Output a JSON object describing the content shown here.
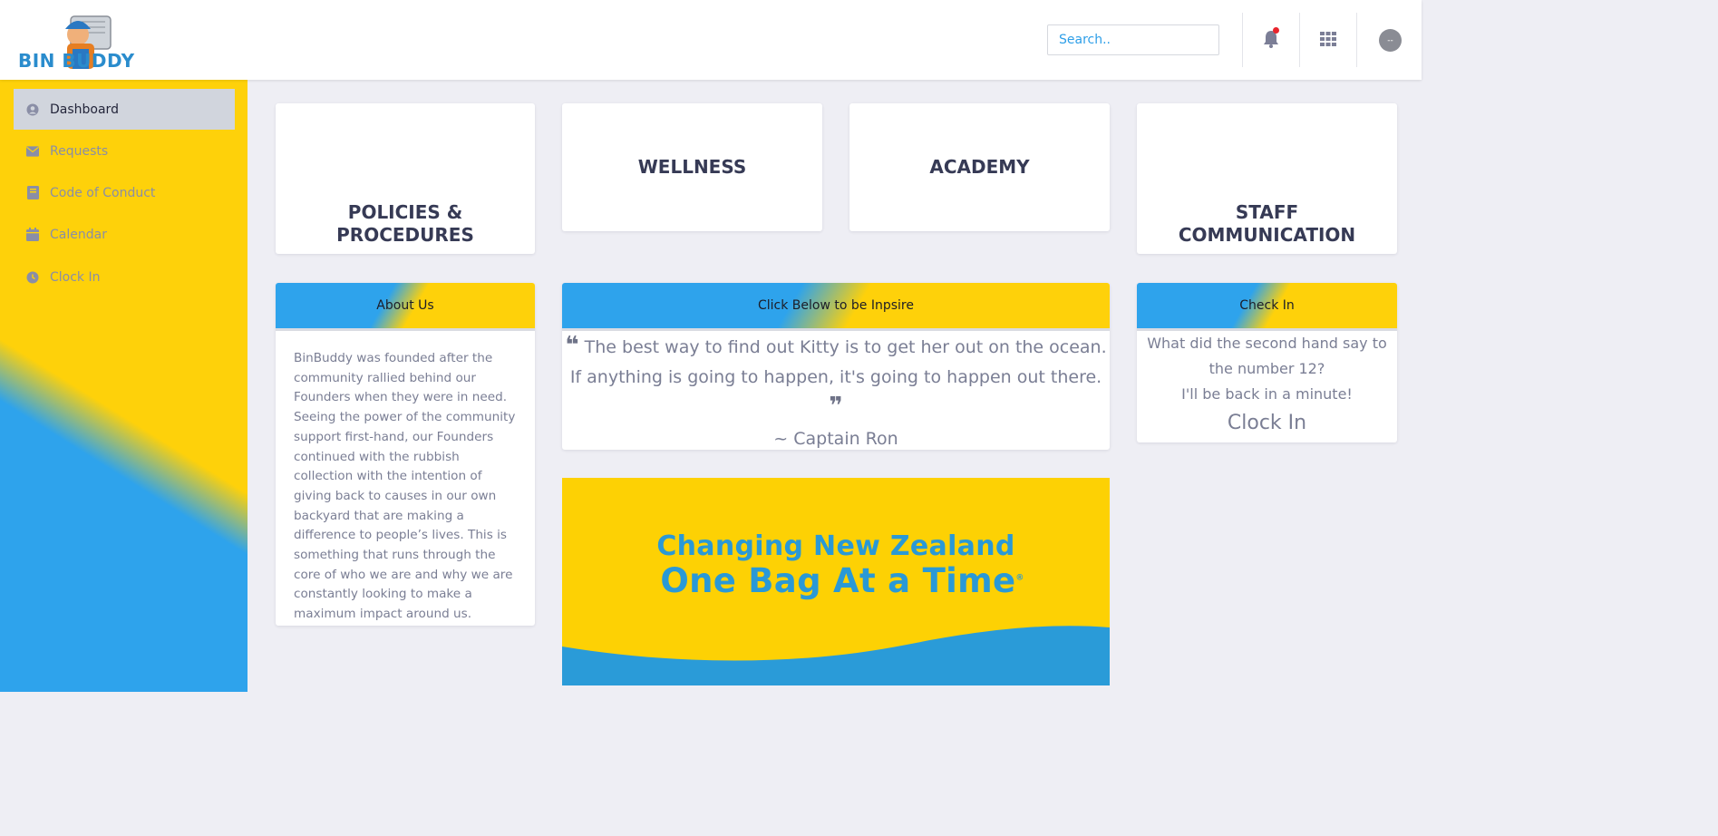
{
  "brand": {
    "logo_text": "BIN BUDDY"
  },
  "header": {
    "search_placeholder": "Search..",
    "avatar_initials": "--"
  },
  "sidebar": {
    "items": [
      {
        "label": "Dashboard",
        "icon": "user-circle-icon",
        "active": true
      },
      {
        "label": "Requests",
        "icon": "envelope-icon"
      },
      {
        "label": "Code of Conduct",
        "icon": "book-icon"
      },
      {
        "label": "Calendar",
        "icon": "calendar-icon"
      },
      {
        "label": "Clock In",
        "icon": "clock-icon"
      }
    ]
  },
  "tiles": {
    "policies_line1": "POLICIES &",
    "policies_line2": "PROCEDURES",
    "wellness": "WELLNESS",
    "academy": "ACADEMY",
    "staff_line1": "STAFF",
    "staff_line2": "COMMUNICATION"
  },
  "about": {
    "title": "About Us",
    "text": "BinBuddy was founded after the community rallied behind our Founders when they were in need. Seeing the power of the community support first-hand, our Founders continued with the rubbish collection with the intention of giving back to causes in our own backyard that are making a difference to people’s lives. This is something that runs through the core of who we are and why we are constantly looking to make a maximum impact around us."
  },
  "inspire": {
    "title": "Click Below to be Inpsire",
    "quote": "The best way to find out Kitty is to get her out on the ocean. If anything is going to happen, it's going to happen out there.",
    "author": "~ Captain Ron"
  },
  "checkin": {
    "title": "Check In",
    "question": "What did the second hand say to the number 12?",
    "answer": "I'll be back in a minute!",
    "link": "Clock In"
  },
  "banner": {
    "line1": "Changing New Zealand",
    "line2": "One Bag At a Time",
    "mark": "®"
  },
  "colors": {
    "brand_blue": "#2ea3ec",
    "brand_yellow": "#fed10a",
    "notification_dot": "#e8242c"
  }
}
